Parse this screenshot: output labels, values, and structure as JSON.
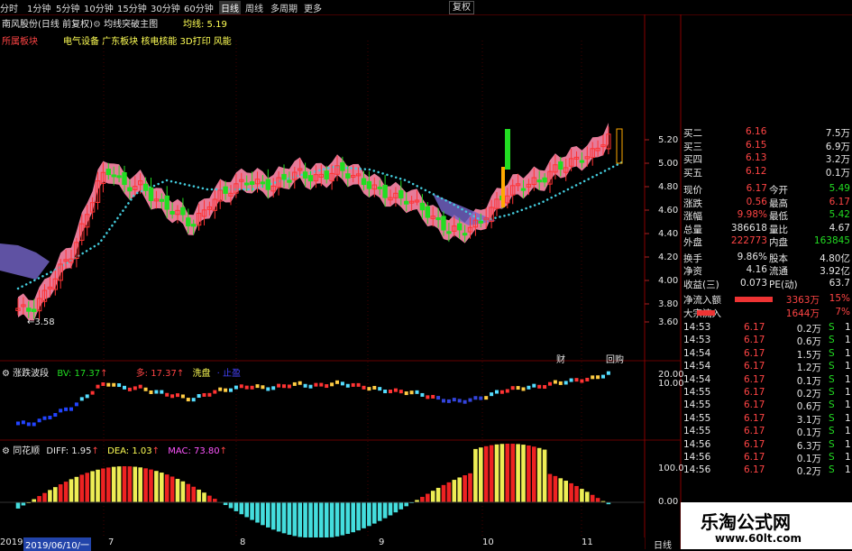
{
  "tabs": [
    "分时",
    "1分钟",
    "5分钟",
    "10分钟",
    "15分钟",
    "30分钟",
    "60分钟",
    "日线",
    "周线",
    "多周期",
    "更多"
  ],
  "active_tab": "日线",
  "toolbar": {
    "restore_label": "复权"
  },
  "main_header": {
    "stock_title": "南风股份(日线 前复权)",
    "indicator_name": "均线突破主图",
    "ma_label": "均线: 5.19",
    "tags_left": "所属板块",
    "tags": "电气设备 广东板块 核电核能 3D打印 风能"
  },
  "price_axis": [
    "5.20",
    "5.00",
    "4.80",
    "4.60",
    "4.40",
    "4.20",
    "4.00",
    "3.80",
    "3.60"
  ],
  "low_marker": "3.58",
  "markers": {
    "cai": "财",
    "hui": "回购"
  },
  "sub1_header": {
    "name": "涨跌波段",
    "bv": "BV: 17.37",
    "duo": "多: 17.37",
    "xipan": "洗盘",
    "qikong": "止盈"
  },
  "sub1_axis": [
    "20.00",
    "10.00"
  ],
  "sub2_header": {
    "name": "同花顺",
    "diff": "DIFF: 1.95",
    "dea": "DEA: 1.03",
    "mac": "MAC: 73.80"
  },
  "sub2_axis": [
    "100.0",
    "0.00"
  ],
  "date_axis": {
    "start": "2019/06/10/一",
    "months": [
      "7",
      "8",
      "9",
      "10",
      "11"
    ],
    "start_prefix": "2019"
  },
  "period_label": "日线",
  "quote": {
    "book": [
      {
        "label": "买二",
        "price": "6.16",
        "vol": "7.5万"
      },
      {
        "label": "买三",
        "price": "6.15",
        "vol": "6.9万"
      },
      {
        "label": "买四",
        "price": "6.13",
        "vol": "3.2万"
      },
      {
        "label": "买五",
        "price": "6.12",
        "vol": "0.1万"
      }
    ],
    "stats": [
      {
        "l1": "现价",
        "v1": "6.17",
        "l2": "今开",
        "v2": "5.49"
      },
      {
        "l1": "涨跌",
        "v1": "0.56",
        "l2": "最高",
        "v2": "6.17"
      },
      {
        "l1": "涨幅",
        "v1": "9.98%",
        "l2": "最低",
        "v2": "5.42"
      },
      {
        "l1": "总量",
        "v1": "386618",
        "l2": "量比",
        "v2": "4.67"
      },
      {
        "l1": "外盘",
        "v1": "222773",
        "l2": "内盘",
        "v2": "163845"
      }
    ],
    "stats2": [
      {
        "l1": "换手",
        "v1": "9.86%",
        "l2": "股本",
        "v2": "4.80亿"
      },
      {
        "l1": "净资",
        "v1": "4.16",
        "l2": "流通",
        "v2": "3.92亿"
      },
      {
        "l1": "收益(三)",
        "v1": "0.073",
        "l2": "PE(动)",
        "v2": "63.7"
      }
    ],
    "flows": [
      {
        "label": "净流入额",
        "value": "3363万",
        "pct": "15%"
      },
      {
        "label": "大宗流入",
        "value": "1644万",
        "pct": "7%"
      }
    ],
    "ticks": [
      {
        "t": "14:53",
        "p": "6.17",
        "v": "0.2万",
        "s": "S",
        "n": "1"
      },
      {
        "t": "14:53",
        "p": "6.17",
        "v": "0.6万",
        "s": "S",
        "n": "1"
      },
      {
        "t": "14:54",
        "p": "6.17",
        "v": "1.5万",
        "s": "S",
        "n": "1"
      },
      {
        "t": "14:54",
        "p": "6.17",
        "v": "1.2万",
        "s": "S",
        "n": "1"
      },
      {
        "t": "14:54",
        "p": "6.17",
        "v": "0.1万",
        "s": "S",
        "n": "1"
      },
      {
        "t": "14:55",
        "p": "6.17",
        "v": "0.2万",
        "s": "S",
        "n": "1"
      },
      {
        "t": "14:55",
        "p": "6.17",
        "v": "0.6万",
        "s": "S",
        "n": "1"
      },
      {
        "t": "14:55",
        "p": "6.17",
        "v": "3.1万",
        "s": "S",
        "n": "1"
      },
      {
        "t": "14:55",
        "p": "6.17",
        "v": "0.1万",
        "s": "S",
        "n": "1"
      },
      {
        "t": "14:56",
        "p": "6.17",
        "v": "6.3万",
        "s": "S",
        "n": "1"
      },
      {
        "t": "14:56",
        "p": "6.17",
        "v": "0.1万",
        "s": "S",
        "n": "1"
      },
      {
        "t": "14:56",
        "p": "6.17",
        "v": "0.2万",
        "s": "S",
        "n": "1"
      }
    ]
  },
  "watermark": {
    "title": "乐淘公式网",
    "url": "www.60lt.com"
  },
  "colors": {
    "up": "#ff3333",
    "down": "#22dd22",
    "band": "#ff88aa",
    "band2": "#7766cc",
    "ma": "#44ccdd",
    "macd_up": "#ee2222",
    "macd_yellow": "#eeee55",
    "macd_down": "#44dddd"
  }
}
